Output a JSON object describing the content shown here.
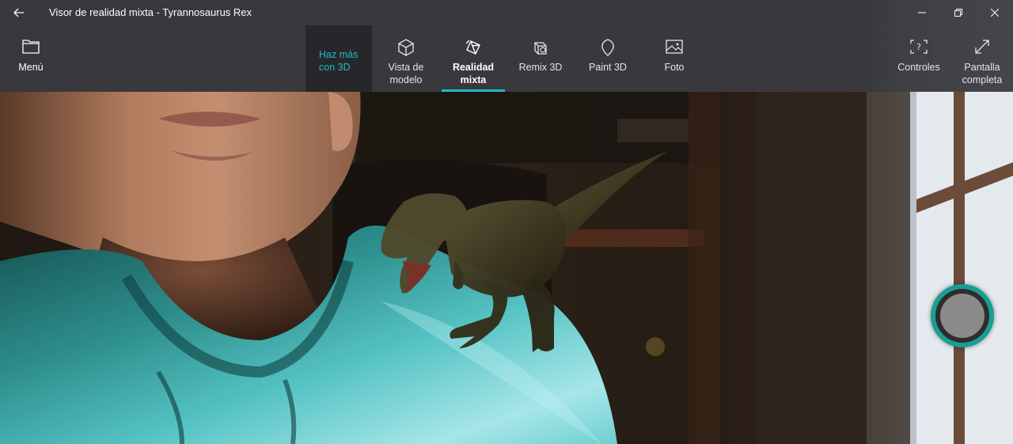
{
  "window": {
    "title": "Visor de realidad mixta - Tyrannosaurus Rex"
  },
  "toolbar": {
    "menu_label": "Menú",
    "promo_label": "Haz más\ncon 3D",
    "tabs": [
      {
        "id": "vista",
        "label": "Vista de\nmodelo",
        "icon": "cube-icon",
        "selected": false
      },
      {
        "id": "realidad",
        "label": "Realidad\nmixta",
        "icon": "mixed-reality-cube-icon",
        "selected": true
      },
      {
        "id": "remix",
        "label": "Remix 3D",
        "icon": "remix-3d-icon",
        "selected": false
      },
      {
        "id": "paint",
        "label": "Paint 3D",
        "icon": "paint-3d-icon",
        "selected": false
      },
      {
        "id": "foto",
        "label": "Foto",
        "icon": "photo-icon",
        "selected": false
      }
    ],
    "controls_label": "Controles",
    "fullscreen_label": "Pantalla\ncompleta"
  },
  "theme": {
    "accent": "#1fbcc8",
    "chrome_bg": "#3a3a40",
    "capture_ring": "#1a9e94"
  }
}
